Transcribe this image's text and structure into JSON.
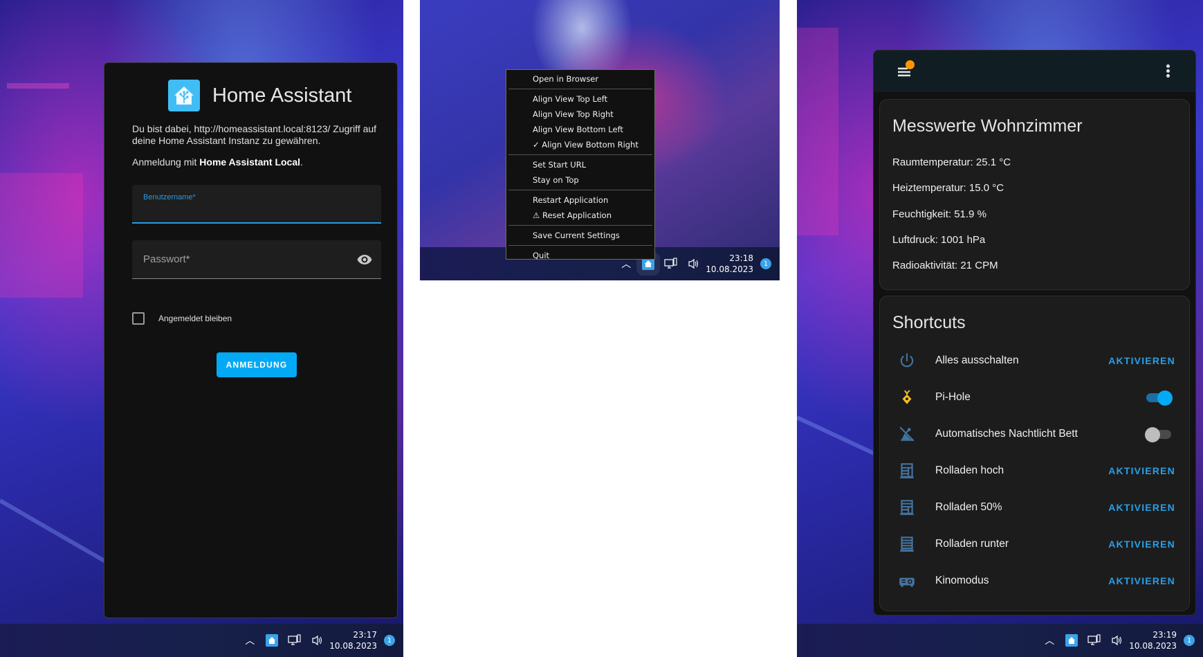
{
  "login": {
    "app_title": "Home Assistant",
    "intro": "Du bist dabei, http://homeassistant.local:8123/ Zugriff auf deine Home Assistant Instanz zu gewähren.",
    "provider_prefix": "Anmeldung mit ",
    "provider_name": "Home Assistant Local",
    "provider_suffix": ".",
    "username_label": "Benutzername*",
    "username_value": "",
    "password_label": "Passwort*",
    "password_value": "",
    "remember_label": "Angemeldet bleiben",
    "remember_checked": false,
    "submit_label": "ANMELDUNG",
    "taskbar": {
      "time": "23:17",
      "date": "10.08.2023",
      "notifications": "1"
    }
  },
  "tray_menu": {
    "items": [
      {
        "label": "Open in Browser"
      },
      {
        "sep": true
      },
      {
        "label": "Align View Top Left"
      },
      {
        "label": "Align View Top Right"
      },
      {
        "label": "Align View Bottom Left"
      },
      {
        "label": "✓ Align View Bottom Right"
      },
      {
        "sep": true
      },
      {
        "label": "Set Start URL"
      },
      {
        "label": "Stay on Top"
      },
      {
        "sep": true
      },
      {
        "label": "Restart Application"
      },
      {
        "label": "⚠ Reset Application"
      },
      {
        "sep": true
      },
      {
        "label": "Save Current Settings"
      },
      {
        "sep": true
      },
      {
        "label": "Quit"
      }
    ],
    "taskbar": {
      "time": "23:18",
      "date": "10.08.2023",
      "notifications": "1"
    }
  },
  "dashboard": {
    "sensors_card": {
      "title": "Messwerte Wohnzimmer",
      "readings": [
        "Raumtemperatur: 25.1 °C",
        "Heiztemperatur: 15.0 °C",
        "Feuchtigkeit: 51.9 %",
        "Luftdruck: 1001 hPa",
        "Radioaktivität: 21 CPM"
      ]
    },
    "shortcuts_card": {
      "title": "Shortcuts",
      "rows": [
        {
          "label": "Alles ausschalten",
          "icon": "power-icon",
          "action": "AKTIVIEREN"
        },
        {
          "label": "Pi-Hole",
          "icon": "pihole-icon",
          "toggle": true
        },
        {
          "label": "Automatisches Nachtlicht Bett",
          "icon": "robot-off-icon",
          "toggle": false
        },
        {
          "label": "Rolladen hoch",
          "icon": "window-shutter-icon",
          "action": "AKTIVIEREN"
        },
        {
          "label": "Rolladen 50%",
          "icon": "window-shutter-icon",
          "action": "AKTIVIEREN"
        },
        {
          "label": "Rolladen runter",
          "icon": "window-shutter-icon",
          "action": "AKTIVIEREN"
        },
        {
          "label": "Kinomodus",
          "icon": "projector-icon",
          "action": "AKTIVIEREN"
        }
      ]
    },
    "colors": {
      "accent": "#03a9f4",
      "action_text": "#2a9fe6",
      "notification_dot": "#ff9800",
      "icon_blue": "#44739e",
      "pihole_yellow": "#f3c022"
    },
    "taskbar": {
      "time": "23:19",
      "date": "10.08.2023",
      "notifications": "1"
    }
  }
}
